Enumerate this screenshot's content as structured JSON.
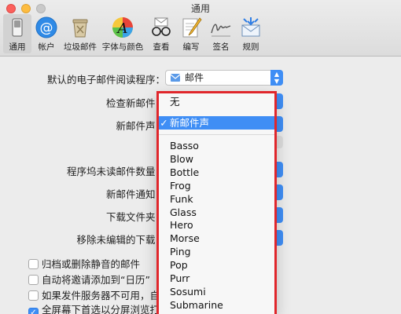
{
  "window": {
    "title": "通用"
  },
  "toolbar": {
    "items": [
      {
        "label": "通用"
      },
      {
        "label": "帐户"
      },
      {
        "label": "垃圾邮件"
      },
      {
        "label": "字体与颜色"
      },
      {
        "label": "查看"
      },
      {
        "label": "编写"
      },
      {
        "label": "签名"
      },
      {
        "label": "规则"
      }
    ]
  },
  "settings": {
    "default_reader_label": "默认的电子邮件阅读程序：",
    "default_reader_value": "邮件",
    "check_mail_label": "检查新邮件：",
    "new_mail_sound_label": "新邮件声：",
    "dock_unread_label": "程序坞未读邮件数量：",
    "new_mail_notify_label": "新邮件通知：",
    "downloads_folder_label": "下载文件夹：",
    "remove_unedited_label": "移除未编辑的下载："
  },
  "checkboxes": [
    {
      "label": "归档或删除静音的邮件",
      "checked": false
    },
    {
      "label": "自动将邀请添加到“日历”",
      "checked": false
    },
    {
      "label": "如果发件服务器不可用，自",
      "checked": false
    },
    {
      "label": "全屏幕下首选以分屏浏览打",
      "checked": true
    }
  ],
  "sound_menu": {
    "none_item": "无",
    "selected_item": "新邮件声",
    "check_mark": "✓",
    "items": [
      "Basso",
      "Blow",
      "Bottle",
      "Frog",
      "Funk",
      "Glass",
      "Hero",
      "Morse",
      "Ping",
      "Pop",
      "Purr",
      "Sosumi",
      "Submarine"
    ]
  },
  "colors": {
    "accent": "#3f8ef5",
    "highlight_box": "#e0262b"
  }
}
